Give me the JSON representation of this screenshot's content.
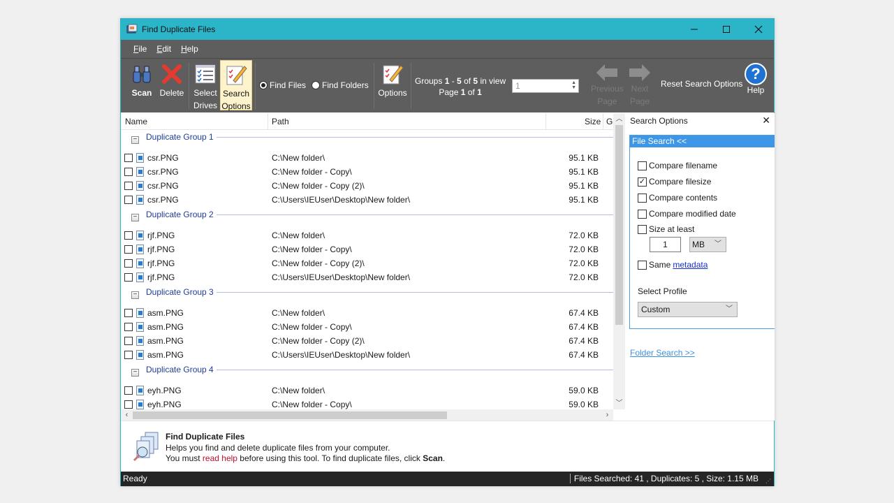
{
  "window": {
    "title": "Find Duplicate Files",
    "controls": {
      "minimize": "—",
      "maximize": "☐",
      "close": "✕"
    }
  },
  "menu": [
    {
      "label": "File",
      "accel": "F",
      "rest": "ile"
    },
    {
      "label": "Edit",
      "accel": "E",
      "rest": "dit"
    },
    {
      "label": "Help",
      "accel": "H",
      "rest": "elp"
    }
  ],
  "toolbar": {
    "scan": "Scan",
    "delete": "Delete",
    "select_drives_1": "Select",
    "select_drives_2": "Drives",
    "search_options_1": "Search",
    "search_options_2": "Options",
    "find_files": "Find Files",
    "find_folders": "Find Folders",
    "find_mode": "files",
    "options": "Options",
    "groups_prefix": "Groups ",
    "groups_from": "1",
    "groups_dash": " - ",
    "groups_to": "5",
    "groups_of": " of ",
    "groups_total": "5",
    "groups_suffix": " in view",
    "page_prefix": "Page ",
    "page_current": "1",
    "page_of": " of ",
    "page_total": "1",
    "page_input": "1",
    "previous_1": "Previous",
    "previous_2": "Page",
    "next_1": "Next",
    "next_2": "Page",
    "reset": "Reset Search Options",
    "help": "Help"
  },
  "list": {
    "columns": {
      "name": "Name",
      "path": "Path",
      "size": "Size",
      "group": "G"
    },
    "groups": [
      {
        "label": "Duplicate Group 1",
        "files": [
          {
            "name": "csr.PNG",
            "path": "C:\\New folder\\",
            "size": "95.1 KB",
            "checked": false
          },
          {
            "name": "csr.PNG",
            "path": "C:\\New folder - Copy\\",
            "size": "95.1 KB",
            "checked": false
          },
          {
            "name": "csr.PNG",
            "path": "C:\\New folder - Copy (2)\\",
            "size": "95.1 KB",
            "checked": false
          },
          {
            "name": "csr.PNG",
            "path": "C:\\Users\\IEUser\\Desktop\\New folder\\",
            "size": "95.1 KB",
            "checked": false
          }
        ]
      },
      {
        "label": "Duplicate Group 2",
        "files": [
          {
            "name": "rjf.PNG",
            "path": "C:\\New folder\\",
            "size": "72.0 KB",
            "checked": false
          },
          {
            "name": "rjf.PNG",
            "path": "C:\\New folder - Copy\\",
            "size": "72.0 KB",
            "checked": false
          },
          {
            "name": "rjf.PNG",
            "path": "C:\\New folder - Copy (2)\\",
            "size": "72.0 KB",
            "checked": false
          },
          {
            "name": "rjf.PNG",
            "path": "C:\\Users\\IEUser\\Desktop\\New folder\\",
            "size": "72.0 KB",
            "checked": false
          }
        ]
      },
      {
        "label": "Duplicate Group 3",
        "files": [
          {
            "name": "asm.PNG",
            "path": "C:\\New folder\\",
            "size": "67.4 KB",
            "checked": false
          },
          {
            "name": "asm.PNG",
            "path": "C:\\New folder - Copy\\",
            "size": "67.4 KB",
            "checked": false
          },
          {
            "name": "asm.PNG",
            "path": "C:\\New folder - Copy (2)\\",
            "size": "67.4 KB",
            "checked": false
          },
          {
            "name": "asm.PNG",
            "path": "C:\\Users\\IEUser\\Desktop\\New folder\\",
            "size": "67.4 KB",
            "checked": false
          }
        ]
      },
      {
        "label": "Duplicate Group 4",
        "files": [
          {
            "name": "eyh.PNG",
            "path": "C:\\New folder\\",
            "size": "59.0 KB",
            "checked": false
          },
          {
            "name": "eyh.PNG",
            "path": "C:\\New folder - Copy\\",
            "size": "59.0 KB",
            "checked": false
          }
        ]
      }
    ]
  },
  "search_options": {
    "title": "Search Options",
    "close": "✕",
    "file_search_header": "File Search <<",
    "compare_filename": {
      "label": "Compare filename",
      "checked": false
    },
    "compare_filesize": {
      "label": "Compare filesize",
      "checked": true
    },
    "compare_contents": {
      "label": "Compare contents",
      "checked": false
    },
    "compare_modified": {
      "label": "Compare modified date",
      "checked": false
    },
    "size_at_least": {
      "label": "Size at least",
      "checked": false,
      "value": "1",
      "unit": "MB"
    },
    "same_metadata": {
      "label": "Same",
      "link": "metadata",
      "checked": false
    },
    "profile_label": "Select Profile",
    "profile_value": "Custom",
    "folder_search_link": "Folder Search >>"
  },
  "info": {
    "title": "Find Duplicate Files",
    "line1": "Helps you find and delete duplicate files from your computer.",
    "line2_a": "You must ",
    "line2_link": "read help",
    "line2_b": " before using this tool. To find duplicate files, click ",
    "line2_bold": "Scan",
    "line2_end": "."
  },
  "status": {
    "left": "Ready",
    "right": "Files Searched: 41 ,  Duplicates: 5 , Size: 1.15 MB"
  }
}
